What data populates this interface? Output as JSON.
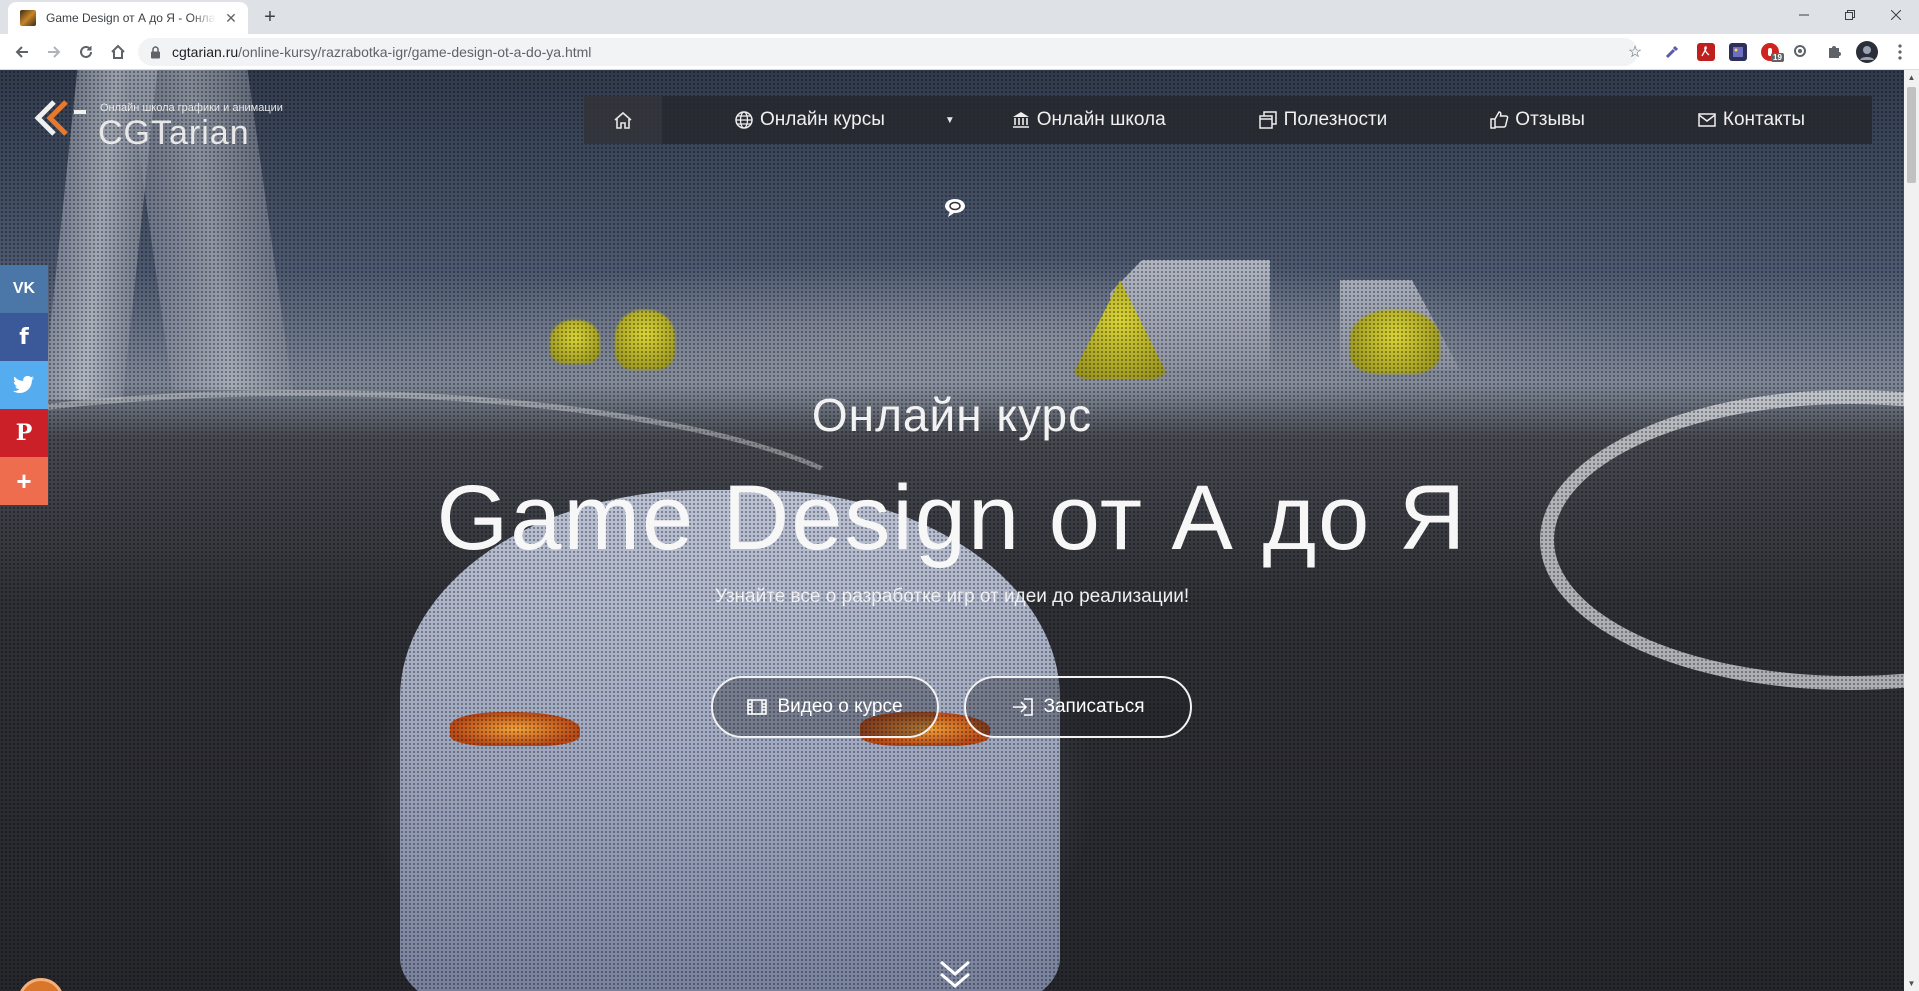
{
  "browser": {
    "tab_title": "Game Design от А до Я - Онлайн курс",
    "new_tab": "+",
    "url_domain": "cgtarian.ru",
    "url_path": "/online-kursy/razrabotka-igr/game-design-ot-a-do-ya.html",
    "extension_badge": "19"
  },
  "logo": {
    "tagline": "Онлайн школа графики и анимации",
    "name": "CGTarian"
  },
  "nav": {
    "items": [
      {
        "label": "Онлайн курсы",
        "icon": "globe-icon"
      },
      {
        "label": "Онлайн школа",
        "icon": "institution-icon"
      },
      {
        "label": "Полезности",
        "icon": "files-icon"
      },
      {
        "label": "Отзывы",
        "icon": "thumbs-up-icon"
      },
      {
        "label": "Контакты",
        "icon": "envelope-icon"
      }
    ]
  },
  "share": {
    "vk": "VK",
    "facebook": "f",
    "twitter": "twitter-icon",
    "pinterest": "P",
    "more": "+",
    "colors": {
      "vk": "#4a76a8",
      "facebook": "#3b5998",
      "twitter": "#55acee",
      "pinterest": "#cb2027",
      "more": "#ef6d4f"
    }
  },
  "hero": {
    "subtitle": "Онлайн курс",
    "title": "Game Design от А до Я",
    "description": "Узнайте все о разработке игр от идеи до реализации!",
    "video_button": "Видео о курсе",
    "enroll_button": "Записаться"
  },
  "colors": {
    "accent": "#e8792b",
    "nav_bg": "#26282e"
  }
}
